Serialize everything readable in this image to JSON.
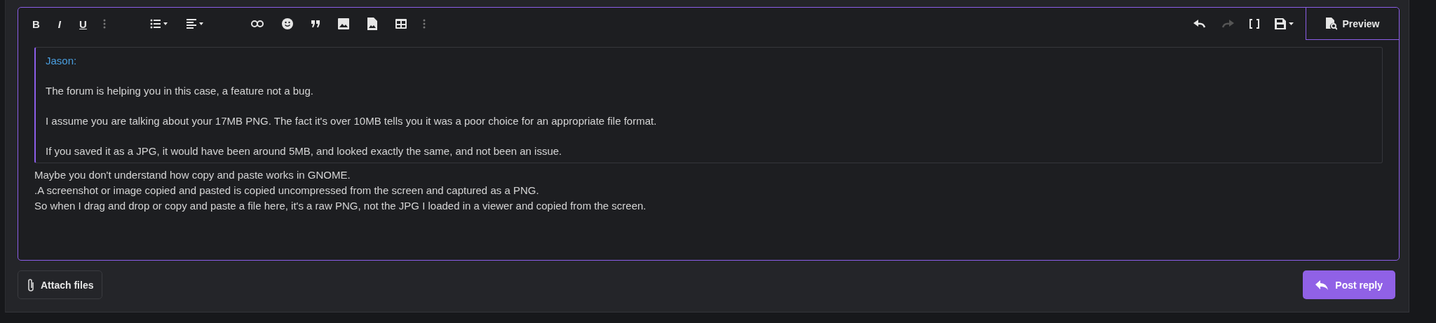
{
  "toolbar": {
    "left": [
      {
        "kind": "bold",
        "label": "B"
      },
      {
        "kind": "italic",
        "label": "I"
      },
      {
        "kind": "underline",
        "label": "U"
      },
      {
        "kind": "more"
      },
      {
        "kind": "gap"
      },
      {
        "kind": "list"
      },
      {
        "kind": "align"
      },
      {
        "kind": "gap"
      },
      {
        "kind": "link"
      },
      {
        "kind": "smiley"
      },
      {
        "kind": "quote"
      },
      {
        "kind": "image"
      },
      {
        "kind": "media"
      },
      {
        "kind": "table"
      },
      {
        "kind": "more"
      }
    ],
    "right": [
      {
        "kind": "undo",
        "disabled": false
      },
      {
        "kind": "redo",
        "disabled": true
      },
      {
        "kind": "brackets",
        "disabled": false
      },
      {
        "kind": "save",
        "disabled": false
      }
    ],
    "preview": {
      "label": "Preview",
      "selected": false
    }
  },
  "quote": {
    "author": "Jason:",
    "paragraphs": [
      "The forum is helping you in this case, a feature not a bug.",
      "I assume you are talking about your 17MB PNG. The fact it's over 10MB tells you it was a poor choice for an appropriate file format.",
      "If you saved it as a JPG, it would have been around 5MB, and looked exactly the same, and not been an issue."
    ]
  },
  "body": [
    "Maybe you don't understand how copy and paste works in GNOME.",
    ".A screenshot or image copied and pasted is copied uncompressed from the screen and captured as a PNG.",
    "So when I drag and drop or copy and paste a file here, it's a raw PNG, not the JPG I loaded in a viewer and copied from the screen."
  ],
  "attach_button": "Attach files",
  "post_button": "Post reply"
}
